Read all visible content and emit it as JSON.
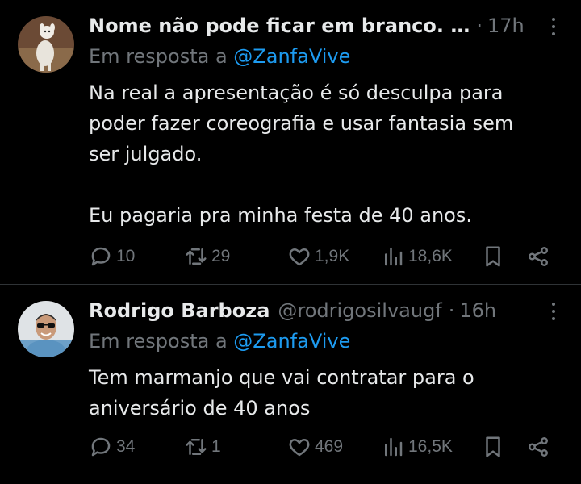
{
  "tweets": [
    {
      "name": "Nome não pode ficar em branco. …",
      "handle": "",
      "dot": "·",
      "time": "17h",
      "reply_prefix": "Em resposta a",
      "reply_mention": "@ZanfaVive",
      "text": "Na real a apresentação é só desculpa para\npoder fazer coreografia e usar fantasia sem\nser julgado.\n\nEu pagaria pra minha festa de 40 anos.",
      "replies": "10",
      "retweets": "29",
      "likes": "1,9K",
      "views": "18,6K"
    },
    {
      "name": "Rodrigo Barboza",
      "handle": "@rodrigosilvaugf",
      "dot": "·",
      "time": "16h",
      "reply_prefix": "Em resposta a",
      "reply_mention": "@ZanfaVive",
      "text": "Tem marmanjo que vai contratar para o\naniversário de 40 anos",
      "replies": "34",
      "retweets": "1",
      "likes": "469",
      "views": "16,5K"
    }
  ],
  "colors": {
    "background": "#000000",
    "text": "#e7e9ea",
    "muted": "#71767b",
    "mention": "#1d9bf0",
    "divider": "#2f3336"
  },
  "icons": [
    "reply-icon",
    "retweet-icon",
    "like-icon",
    "views-icon",
    "bookmark-icon",
    "share-icon",
    "more-icon"
  ]
}
